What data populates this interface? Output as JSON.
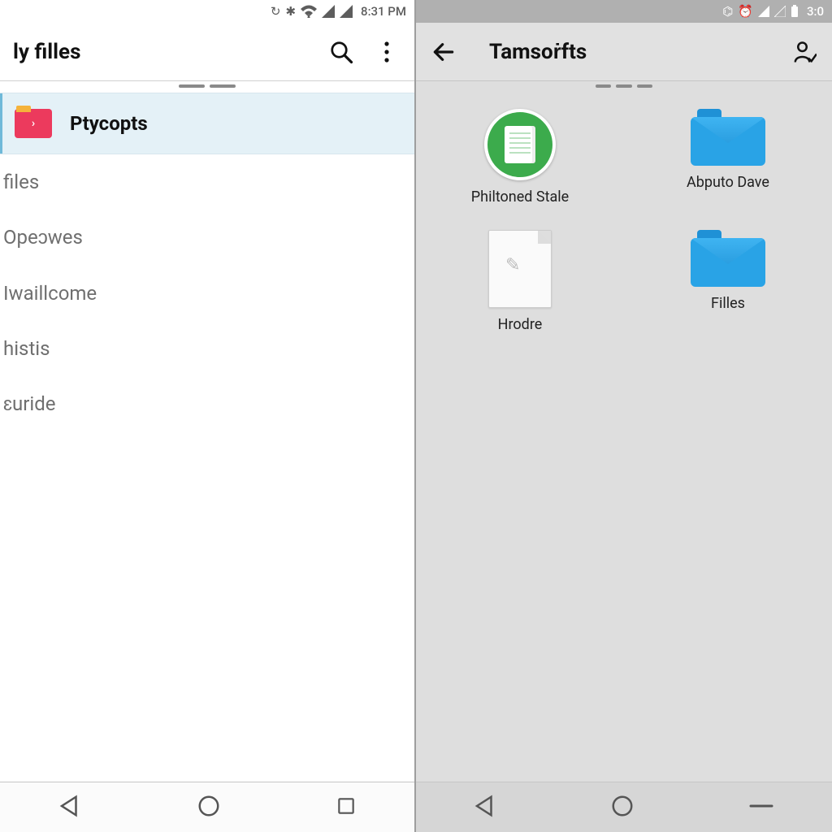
{
  "left": {
    "status": {
      "time": "8:31 PM"
    },
    "appbar": {
      "title": "ly filles"
    },
    "selected": {
      "label": "Ptycopts"
    },
    "items": [
      "files",
      "Opeɔwes",
      "Iwaillcome",
      "histis",
      "ɛuride"
    ]
  },
  "right": {
    "status": {
      "time": "3:0"
    },
    "appbar": {
      "title": "Tamsoṙfts"
    },
    "grid": [
      {
        "label": "Philtoned Stale",
        "kind": "app"
      },
      {
        "label": "Abputo Dave",
        "kind": "folder"
      },
      {
        "label": "Hrodre",
        "kind": "file"
      },
      {
        "label": "Filles",
        "kind": "folder"
      }
    ]
  }
}
